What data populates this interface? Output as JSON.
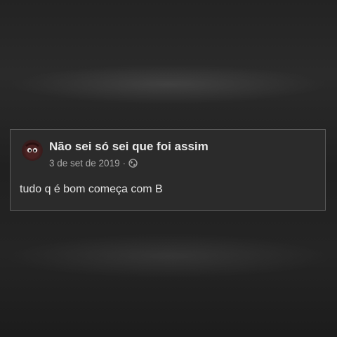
{
  "post": {
    "author": "Não sei só sei que foi assim",
    "date": "3 de set de 2019",
    "separator": "·",
    "privacy_icon": "globe-icon",
    "text": "tudo q é bom começa com B"
  },
  "colors": {
    "background": "#1e1e1e",
    "card_background": "#2b2b2b",
    "card_border": "#5a5a5a",
    "text_primary": "#e9e9e9",
    "text_secondary": "#a9a9a9"
  }
}
